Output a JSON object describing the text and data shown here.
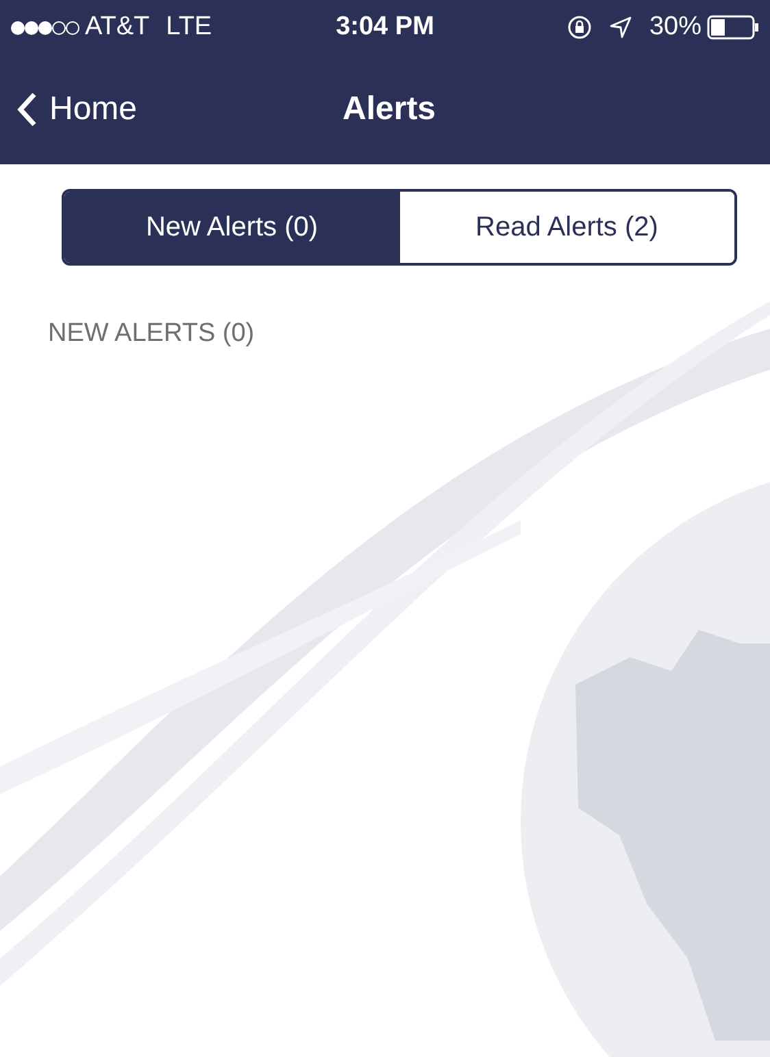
{
  "status_bar": {
    "carrier": "AT&T",
    "network": "LTE",
    "time": "3:04 PM",
    "battery": "30%"
  },
  "nav_bar": {
    "back": "Home",
    "title": "Alerts"
  },
  "tabs": [
    {
      "label": "New Alerts (0)",
      "selected": true
    },
    {
      "label": "Read Alerts (2)",
      "selected": false
    }
  ],
  "section_header": "NEW ALERTS (0)"
}
